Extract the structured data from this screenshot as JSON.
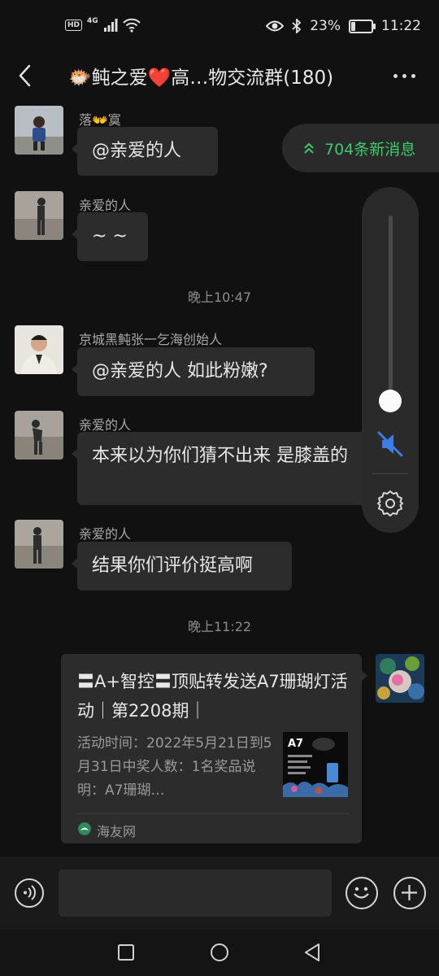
{
  "status_bar": {
    "hd": "HD",
    "network": "4G",
    "battery": "23%",
    "battery_level": 0.23,
    "time": "11:22"
  },
  "header": {
    "title": "🐡鲀之爱❤️高…物交流群(180)"
  },
  "new_messages": {
    "label": "704条新消息"
  },
  "messages": [
    {
      "sender": "落👐寞",
      "text": "@亲爱的人"
    },
    {
      "sender": "亲爱的人",
      "text": "~ ~"
    },
    {
      "sender": "京城黑鲀张一乞海创始人",
      "text": "@亲爱的人  如此粉嫩?"
    },
    {
      "sender": "亲爱的人",
      "text": "本来以为你们猜不出来 是膝盖的"
    },
    {
      "sender": "亲爱的人",
      "text": "结果你们评价挺高啊"
    }
  ],
  "timestamps": [
    "晚上10:47",
    "晚上11:22"
  ],
  "link_card": {
    "title": "〓A+智控〓顶贴转发送A7珊瑚灯活动｜第2208期｜",
    "description": "活动时间：2022年5月21日到5月31日中奖人数：1名奖品说明：A7珊瑚…",
    "thumb_label": "A7",
    "source": "海友网"
  },
  "volume": {
    "level": 0.05,
    "muted": true
  },
  "colors": {
    "background": "#111111",
    "bubble": "#2c2c2c",
    "new_messages_green": "#3ec96b",
    "mute_blue": "#3b7ce6"
  }
}
